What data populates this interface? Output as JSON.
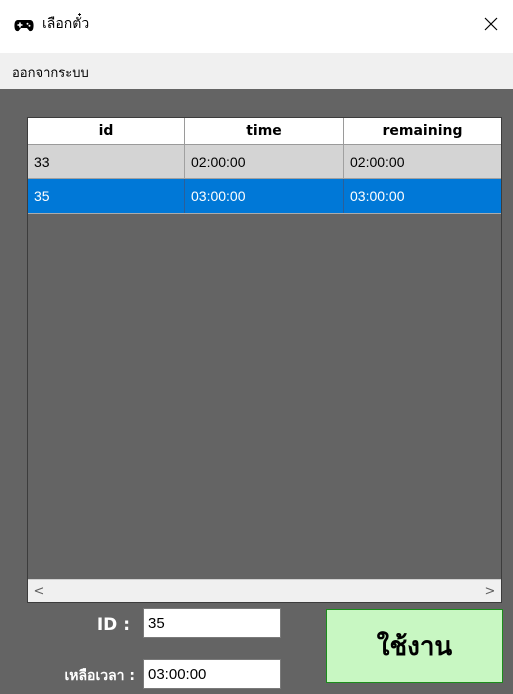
{
  "window": {
    "title": "เลือกตั๋ว",
    "close_glyph": "✕"
  },
  "menu": {
    "items": [
      "ออกจากระบบ"
    ]
  },
  "table": {
    "columns": [
      "id",
      "time",
      "remaining"
    ],
    "rows": [
      {
        "id": "33",
        "time": "02:00:00",
        "remaining": "02:00:00",
        "selected": false
      },
      {
        "id": "35",
        "time": "03:00:00",
        "remaining": "03:00:00",
        "selected": true
      }
    ],
    "scroll_left": "<",
    "scroll_right": ">"
  },
  "form": {
    "id_label": "ID :",
    "id_value": "35",
    "remaining_label": "เหลือเวลา :",
    "remaining_value": "03:00:00",
    "use_button": "ใช้งาน"
  },
  "colors": {
    "background": "#646464",
    "selected_row": "#0078d7",
    "use_button_bg": "#c8f7c2",
    "use_button_border": "#1b8c1b"
  },
  "icons": {
    "app": "gamepad-icon",
    "close": "close-icon"
  }
}
